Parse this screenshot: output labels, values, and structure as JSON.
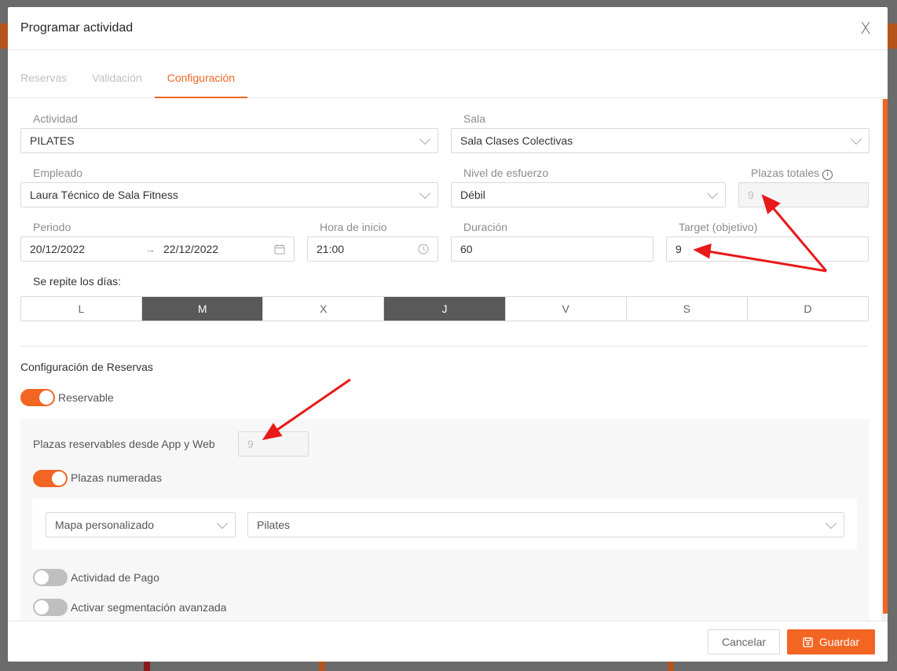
{
  "modal": {
    "title": "Programar actividad",
    "close": "X"
  },
  "tabs": [
    {
      "label": "Reservas"
    },
    {
      "label": "Validación"
    },
    {
      "label": "Configuración"
    }
  ],
  "form": {
    "actividad": {
      "label": "Actividad",
      "value": "PILATES"
    },
    "sala": {
      "label": "Sala",
      "value": "Sala Clases Colectivas"
    },
    "empleado": {
      "label": "Empleado",
      "value": "Laura Técnico de Sala Fitness"
    },
    "nivel": {
      "label": "Nivel de esfuerzo",
      "value": "Débil"
    },
    "plazas_totales": {
      "label": "Plazas totales",
      "value": "9"
    },
    "periodo": {
      "label": "Periodo",
      "start": "20/12/2022",
      "end": "22/12/2022",
      "arrow": "→"
    },
    "hora_inicio": {
      "label": "Hora de inicio",
      "value": "21:00"
    },
    "duracion": {
      "label": "Duración",
      "value": "60"
    },
    "target": {
      "label": "Target (objetivo)",
      "value": "9"
    },
    "repite_label": "Se repite los días:",
    "days": [
      {
        "label": "L",
        "selected": false
      },
      {
        "label": "M",
        "selected": true
      },
      {
        "label": "X",
        "selected": false
      },
      {
        "label": "J",
        "selected": true
      },
      {
        "label": "V",
        "selected": false
      },
      {
        "label": "S",
        "selected": false
      },
      {
        "label": "D",
        "selected": false
      }
    ]
  },
  "reservas": {
    "section_title": "Configuración de Reservas",
    "reservable": {
      "label": "Reservable",
      "on": true
    },
    "plazas_app": {
      "label": "Plazas reservables desde App y Web",
      "value": "9"
    },
    "numeradas": {
      "label": "Plazas numeradas",
      "on": true
    },
    "mapa": {
      "value": "Mapa personalizado"
    },
    "mapa_nombre": {
      "value": "Pilates"
    },
    "pago": {
      "label": "Actividad de Pago",
      "on": false
    },
    "segmentacion": {
      "label": "Activar segmentación avanzada",
      "on": false
    }
  },
  "footer": {
    "cancel": "Cancelar",
    "save": "Guardar"
  },
  "colors": {
    "accent": "#f26522",
    "annotation": "#e8191a"
  }
}
